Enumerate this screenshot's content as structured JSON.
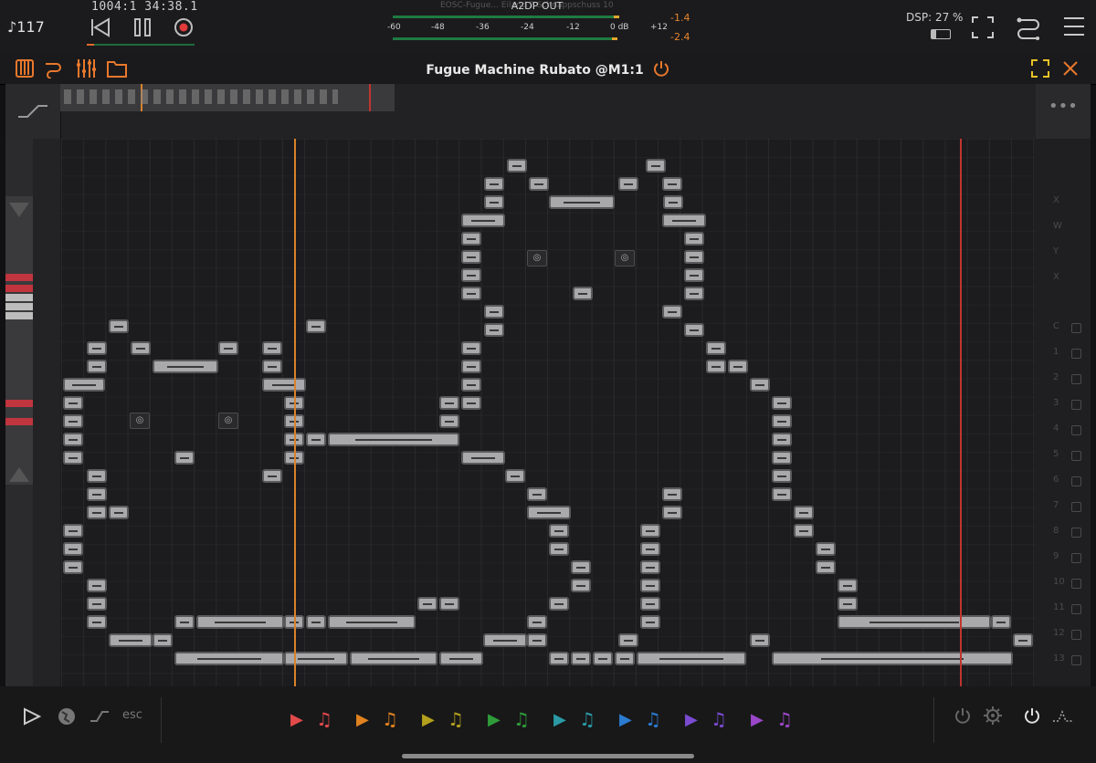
{
  "topbar": {
    "tempo": "♪117",
    "position": "1004:1  34:38.1",
    "meter_title": "A2DP OUT",
    "window_ghost_title": "EOSC-Fugue...  Eiland 2 Schnappschuss 10",
    "scale": [
      "-60",
      "-48",
      "-36",
      "-24",
      "-12",
      "0 dB",
      "+12"
    ],
    "peak_top": "-1.4",
    "peak_bottom": "-2.4",
    "dsp": "DSP: 27 %",
    "meter_level_fraction": 0.88,
    "battery_fraction": 0.25
  },
  "header": {
    "title": "Fugue Machine Rubato @M1:1"
  },
  "colors": {
    "accent": "#e9782c",
    "note": "#a9a9ab",
    "meter_green": "#1f7a42",
    "playhead_orange": "#d9822b",
    "loop_end_red": "#c0352f"
  },
  "piano_roll": {
    "notes_description_free": true,
    "right_labels": [
      "C",
      "1",
      "2",
      "3",
      "4",
      "5",
      "6",
      "7",
      "8",
      "9",
      "10",
      "11",
      "12",
      "13"
    ],
    "right_letters": [
      "X",
      "W",
      "Y",
      "X"
    ]
  },
  "bottombar": {
    "esc_label": "esc",
    "tracks": [
      {
        "color": "#e24a4a"
      },
      {
        "color": "#e0821f"
      },
      {
        "color": "#b3a01c"
      },
      {
        "color": "#2f9c3a"
      },
      {
        "color": "#2a9aa5"
      },
      {
        "color": "#2b7bd1"
      },
      {
        "color": "#7a4bd0"
      },
      {
        "color": "#9b47c9"
      }
    ]
  }
}
